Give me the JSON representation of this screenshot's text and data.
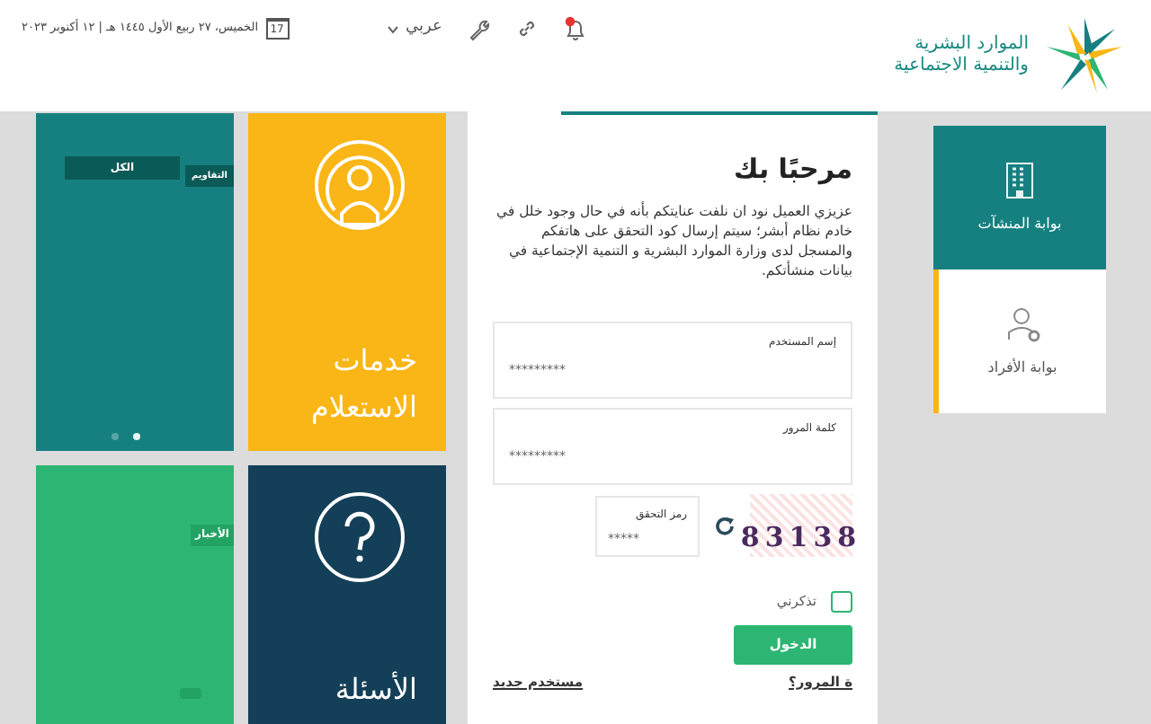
{
  "header": {
    "logo_lines": [
      "الموارد البشرية",
      "والتنمية الاجتماعية"
    ],
    "date": "الخميس، ٢٧ ربيع الأول ١٤٤٥ هـ | ١٢ أكتوبر ٢٠٢٣",
    "calendar_day": "17",
    "language": "عربي",
    "notifications_unread": true
  },
  "portals": [
    {
      "label": "بوابة المنشآت",
      "selected": true,
      "kind": "building"
    },
    {
      "label": "بوابة الأفراد",
      "selected": false,
      "kind": "person"
    }
  ],
  "login": {
    "title": "مرحبًا بك",
    "message": "عزيزي العميل نود ان نلفت عنايتكم بأنه في حال وجود خلل في خادم نظام أبشر؛ سيتم إرسال كود التحقق على هاتفكم والمسجل لدى وزارة الموارد البشرية و التنمية الإجتماعية في بيانات منشأتكم.",
    "fields": [
      {
        "label": "إسم المستخدم",
        "value": "*********"
      },
      {
        "label": "كلمة المرور",
        "value": "*********"
      }
    ],
    "captcha": {
      "label": "رمز التحقق",
      "value": "*****",
      "code": "83138"
    },
    "remember": {
      "label": "تذكرني",
      "checked": false
    },
    "submit": "الدخول",
    "forgot": "ة المرور؟",
    "new_user": "مستخدم جديد"
  },
  "tiles": [
    {
      "kind": "inquiry",
      "title": "خدمات الاستعلام",
      "color": "#f9b616"
    },
    {
      "kind": "slider",
      "color": "#168080",
      "tags": [
        {
          "label": "التقاويم"
        },
        {
          "label": "الكل"
        }
      ],
      "dots": [
        {
          "selected": true
        },
        {
          "selected": false
        }
      ]
    },
    {
      "kind": "faq",
      "title": "الأسئلة",
      "color": "#143f58"
    },
    {
      "kind": "news",
      "color": "#2db673",
      "tags": [
        {
          "label": "الأخبار"
        }
      ]
    }
  ]
}
